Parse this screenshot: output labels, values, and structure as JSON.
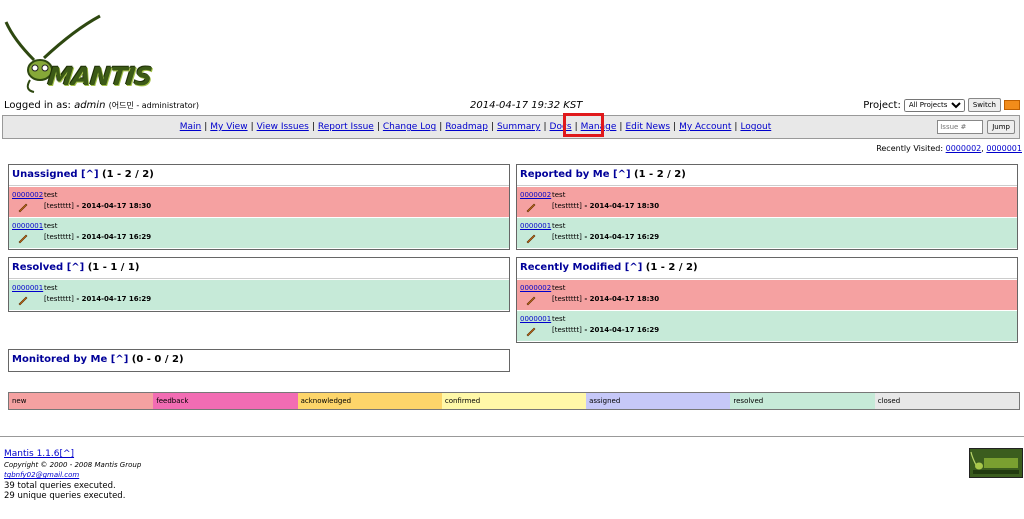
{
  "logo": {
    "text": "MANTIS"
  },
  "top": {
    "logged_in_prefix": "Logged in as: ",
    "username": "admin",
    "role": "(어드민 - administrator)",
    "datetime": "2014-04-17 19:32 KST",
    "project_label": "Project:",
    "project_value": "All Projects",
    "switch_label": "Switch",
    "rss_icon": "rss-icon"
  },
  "menu": {
    "items": [
      "Main",
      "My View",
      "View Issues",
      "Report Issue",
      "Change Log",
      "Roadmap",
      "Summary",
      "Docs",
      "Manage",
      "Edit News",
      "My Account",
      "Logout"
    ],
    "separator": "|",
    "issue_placeholder": "Issue #",
    "jump_label": "Jump",
    "highlighted_item": "Manage",
    "highlight_color": "#e0191b"
  },
  "recently_visited": {
    "label": "Recently Visited: ",
    "ids": [
      "0000002",
      "0000001"
    ],
    "sep": ", "
  },
  "boxes": {
    "unassigned": {
      "title": "Unassigned",
      "caret": "[^]",
      "count": "(1 - 2 / 2)",
      "rows": [
        {
          "id": "0000002",
          "summary": "test",
          "category": "[testtttt]",
          "date": " - 2014-04-17 18:30",
          "color": "red"
        },
        {
          "id": "0000001",
          "summary": "test",
          "category": "[testtttt]",
          "date": " - 2014-04-17 16:29",
          "color": "green"
        }
      ]
    },
    "reported": {
      "title": "Reported by Me",
      "caret": "[^]",
      "count": "(1 - 2 / 2)",
      "rows": [
        {
          "id": "0000002",
          "summary": "test",
          "category": "[testtttt]",
          "date": " - 2014-04-17 18:30",
          "color": "red"
        },
        {
          "id": "0000001",
          "summary": "test",
          "category": "[testtttt]",
          "date": " - 2014-04-17 16:29",
          "color": "green"
        }
      ]
    },
    "resolved": {
      "title": "Resolved",
      "caret": "[^]",
      "count": "(1 - 1 / 1)",
      "rows": [
        {
          "id": "0000001",
          "summary": "test",
          "category": "[testtttt]",
          "date": " - 2014-04-17 16:29",
          "color": "green"
        }
      ]
    },
    "modified": {
      "title": "Recently Modified",
      "caret": "[^]",
      "count": "(1 - 2 / 2)",
      "rows": [
        {
          "id": "0000002",
          "summary": "test",
          "category": "[testtttt]",
          "date": " - 2014-04-17 18:30",
          "color": "red"
        },
        {
          "id": "0000001",
          "summary": "test",
          "category": "[testtttt]",
          "date": " - 2014-04-17 16:29",
          "color": "green"
        }
      ]
    },
    "monitored": {
      "title": "Monitored by Me",
      "caret": "[^]",
      "count": "(0 - 0 / 2)",
      "rows": []
    }
  },
  "legend": [
    {
      "label": "new",
      "color": "#f5a1a1"
    },
    {
      "label": "feedback",
      "color": "#f26cb3"
    },
    {
      "label": "acknowledged",
      "color": "#fdd56a"
    },
    {
      "label": "confirmed",
      "color": "#fff8a8"
    },
    {
      "label": "assigned",
      "color": "#c6c8f8"
    },
    {
      "label": "resolved",
      "color": "#c6ead8"
    },
    {
      "label": "closed",
      "color": "#e8e8e8"
    }
  ],
  "footer": {
    "version": "Mantis 1.1.6",
    "caret": "[^]",
    "copyright": "Copyright © 2000 - 2008 Mantis Group",
    "email": "tqbnfy02@gmail.com",
    "total_queries": "39 total queries executed.",
    "unique_queries": "29 unique queries executed."
  },
  "status_colors": {
    "red": "#f5a1a1",
    "green": "#c6ead8"
  }
}
